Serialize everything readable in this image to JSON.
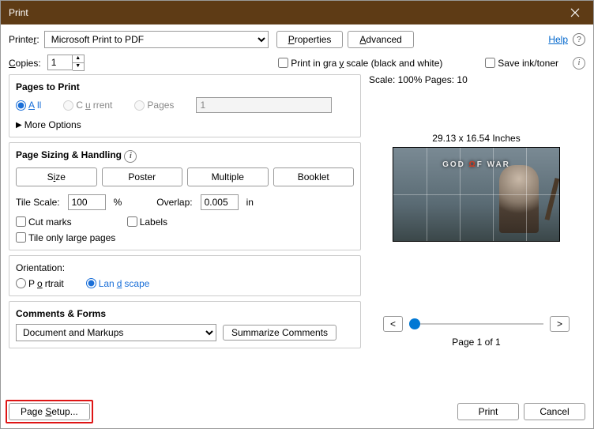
{
  "window": {
    "title": "Print"
  },
  "printer": {
    "label": "Printer:",
    "label_und": "r",
    "value": "Microsoft Print to PDF"
  },
  "buttons": {
    "properties": "Properties",
    "properties_und": "P",
    "advanced": "Advanced",
    "advanced_und": "A",
    "summarize": "Summarize Comments",
    "page_setup": "Page Setup...",
    "page_setup_und": "S",
    "print": "Print",
    "cancel": "Cancel"
  },
  "help": "Help",
  "copies": {
    "label": "Copies:",
    "label_und": "C",
    "value": "1"
  },
  "grayscale": "Print in grayscale (black and white)",
  "grayscale_und": "y",
  "save_ink": "Save ink/toner",
  "pages": {
    "title": "Pages to Print",
    "all": "All",
    "all_und": "A",
    "current": "Current",
    "current_und": "u",
    "pages": "Pages",
    "value": "1",
    "more": "More Options"
  },
  "sizing": {
    "title": "Page Sizing & Handling",
    "size": "Size",
    "size_und": "i",
    "poster": "Poster",
    "multiple": "Multiple",
    "booklet": "Booklet",
    "tile_scale_label": "Tile Scale:",
    "tile_scale": "100",
    "percent": "%",
    "overlap_label": "Overlap:",
    "overlap": "0.005",
    "unit": "in",
    "cut_marks": "Cut marks",
    "labels": "Labels",
    "tile_large": "Tile only large pages"
  },
  "orientation": {
    "title": "Orientation:",
    "portrait": "Portrait",
    "portrait_und": "o",
    "landscape": "Landscape",
    "landscape_und": "d"
  },
  "comments": {
    "title": "Comments & Forms",
    "value": "Document and Markups"
  },
  "preview": {
    "scale_pages": "Scale: 100% Pages: 10",
    "dimensions": "29.13 x 16.54 Inches",
    "logo_left": "GOD",
    "logo_omega": "Ω",
    "logo_right": "F WAR",
    "page_of": "Page 1 of 1",
    "prev": "<",
    "next": ">"
  }
}
